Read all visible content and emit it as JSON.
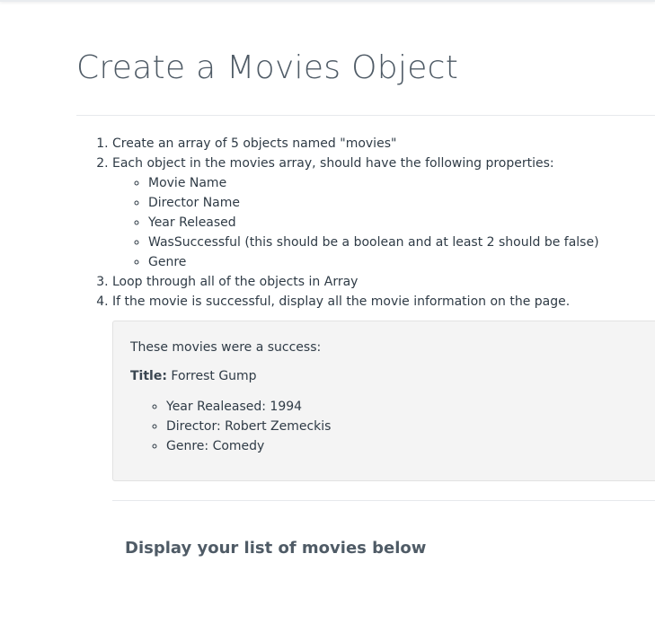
{
  "page": {
    "title": "Create a Movies Object",
    "steps": [
      "Create an array of 5 objects named \"movies\"",
      "Each object in the movies array, should have the following properties:",
      "Loop through all of the objects in Array",
      "If the movie is successful, display all the movie information on the page."
    ],
    "properties": [
      "Movie Name",
      "Director Name",
      "Year Released",
      "WasSuccessful (this should be a boolean and at least 2 should be false)",
      "Genre"
    ]
  },
  "output": {
    "intro": "These movies were a success:",
    "movie": {
      "title_label": "Title:",
      "title_value": "Forrest Gump",
      "details": [
        "Year Realeased: 1994",
        "Director: Robert Zemeckis",
        "Genre: Comedy"
      ]
    }
  },
  "section": {
    "heading": "Display your list of movies below"
  }
}
